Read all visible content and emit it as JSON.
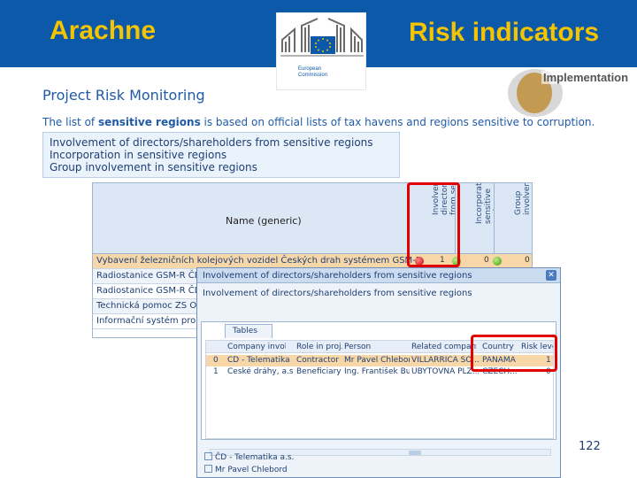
{
  "header": {
    "brand": "Arachne",
    "title": "Risk indicators",
    "logo_text_line1": "European",
    "logo_text_line2": "Commission"
  },
  "badge": {
    "label": "Implementation"
  },
  "section_title": "Project Risk Monitoring",
  "intro": {
    "before": "The list of ",
    "bold": "sensitive regions",
    "after": " is based on official lists of tax havens and regions sensitive to corruption."
  },
  "criteria": [
    "Involvement of directors/shareholders from sensitive regions",
    "Incorporation in sensitive regions",
    "Group involvement in sensitive regions"
  ],
  "grid": {
    "name_header": "Name (generic)",
    "vertical_headers": [
      "Involvement of directors/shareholders from sensitive regions",
      "Incorporation in sensitive regions",
      "Group involvement in sensitive regions"
    ],
    "rows": [
      {
        "name": "Vybavení železničních kolejových vozidel Českých drah systémem GSM-R",
        "v1": "1",
        "v2": "0",
        "v3": "0"
      },
      {
        "name": "Radiostanice GSM-R ČD",
        "v1": "",
        "v2": "",
        "v3": ""
      },
      {
        "name": "Radiostanice GSM-R ČD",
        "v1": "",
        "v2": "",
        "v3": ""
      },
      {
        "name": "Technická pomoc ZS OP",
        "v1": "",
        "v2": "",
        "v3": ""
      },
      {
        "name": "Informační systém pro ce",
        "v1": "",
        "v2": "",
        "v3": ""
      }
    ]
  },
  "popup": {
    "title": "Involvement of directors/shareholders from sensitive regions",
    "subtitle": "Involvement of directors/shareholders from sensitive regions",
    "close_icon": "close-icon",
    "tab_label": "Tables",
    "columns": [
      "Company involved",
      "Role in proj...",
      "Person",
      "Related company",
      "Country",
      "Risk level"
    ],
    "rows": [
      {
        "idx": "0",
        "company": "ČD - Telematika ...",
        "role": "Contractor",
        "person": "Mr Pavel Chlebor...",
        "related": "VILLARRICA SO...",
        "country": "PANAMA",
        "risk": "1"
      },
      {
        "idx": "1",
        "company": "České dráhy, a.s.",
        "role": "Beneficiary",
        "person": "Ing. František Bur...",
        "related": "UBYTOVNA PLZ...",
        "country": "CZECH...",
        "risk": "0"
      }
    ],
    "tree": [
      "ČD - Telematika a.s.",
      "Mr Pavel Chlebord"
    ]
  },
  "slide_number": "122"
}
